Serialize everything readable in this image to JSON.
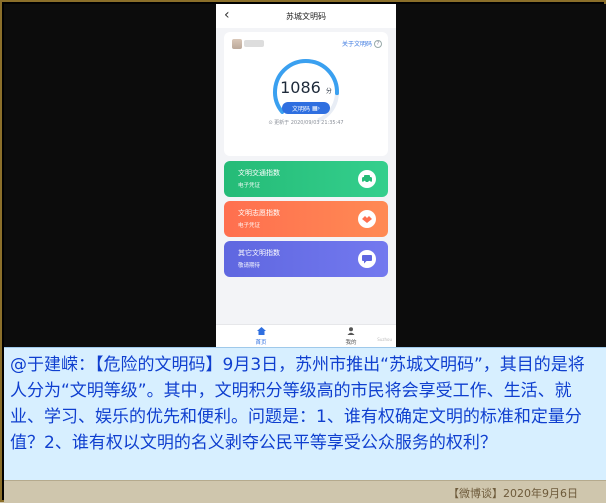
{
  "nav": {
    "back_glyph": "‹",
    "title": "苏城文明码"
  },
  "profile": {
    "about_text": "关于文明码",
    "help_glyph": "?"
  },
  "score": {
    "value": "1086",
    "unit": "分"
  },
  "code_button": {
    "label": "文明码",
    "icon": "qr-code-icon"
  },
  "update_text": "⊙ 更新于 2020/09/03 21:35:47",
  "tiles": [
    {
      "title": "文明交通指数",
      "subtitle": "电子凭证",
      "icon": "car-icon"
    },
    {
      "title": "文明志愿指数",
      "subtitle": "电子凭证",
      "icon": "handshake-icon"
    },
    {
      "title": "其它文明指数",
      "subtitle": "敬请期待",
      "icon": "chat-icon"
    }
  ],
  "tabbar": [
    {
      "label": "首页",
      "icon": "home-icon"
    },
    {
      "label": "我的",
      "icon": "user-icon"
    }
  ],
  "watermark": "Suzhou",
  "caption": "@于建嵘：【危险的文明码】9月3日，苏州市推出“苏城文明码”，其目的是将人分为“文明等级”。其中，文明积分等级高的市民将会享受工作、生活、就业、学习、娱乐的优先和便利。问题是：1、谁有权确定文明的标准和定量分值？2、谁有权以文明的名义剥夺公民平等享受公众服务的权利？",
  "footer_source": "【微博谈】2020年9月6日",
  "colors": {
    "traffic": "#25bb77",
    "volunteer": "#ff6f4f",
    "other": "#5f67e0",
    "accent": "#2f6fe0",
    "caption_text": "#0f3fcf"
  }
}
